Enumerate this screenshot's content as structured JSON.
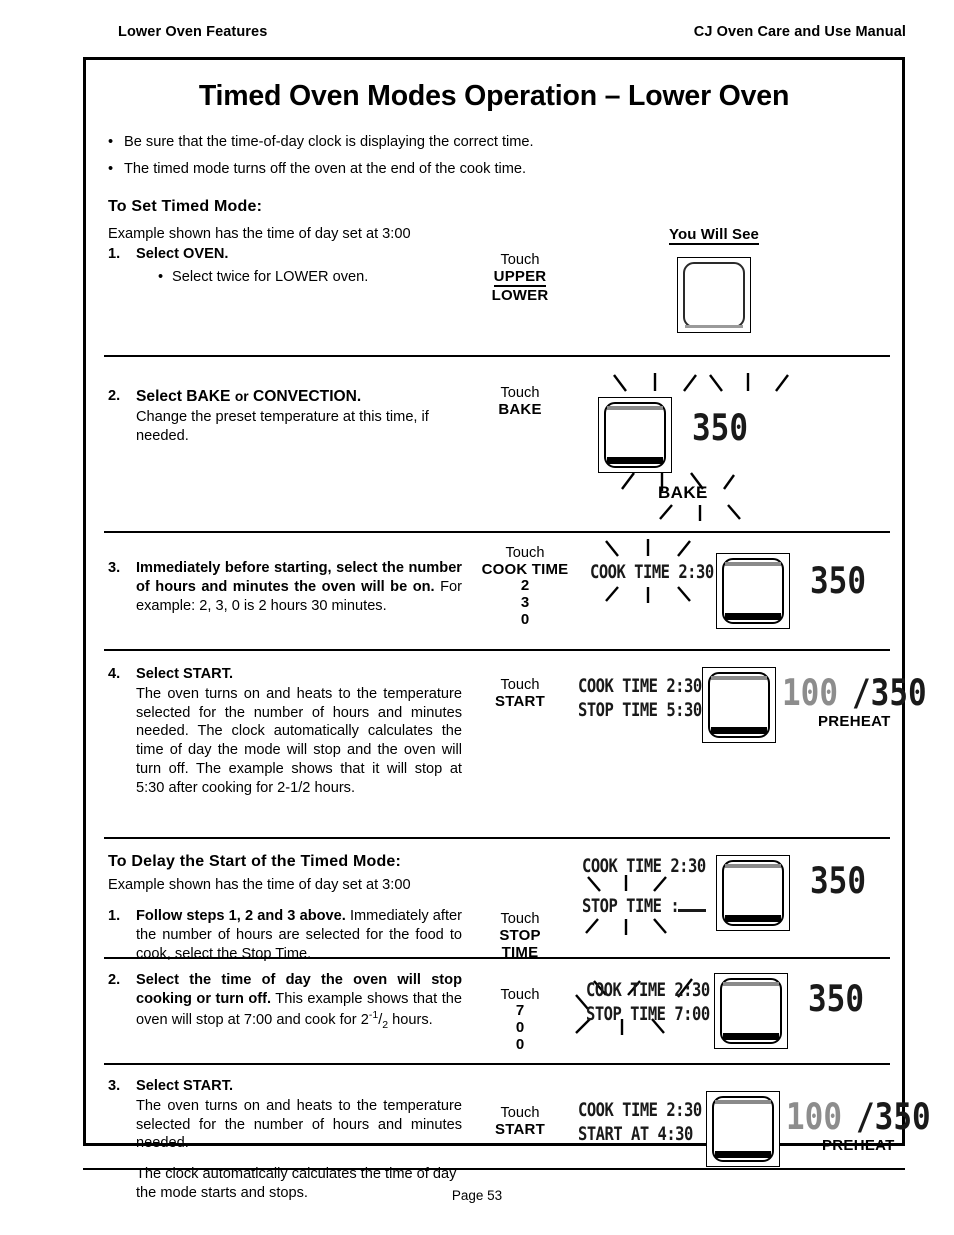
{
  "runhead": {
    "left": "Lower Oven Features",
    "right": "CJ Oven Care and Use Manual"
  },
  "title": "Timed Oven Modes Operation – Lower Oven",
  "intro_bullets": [
    "Be sure that the time-of-day clock is displaying the correct time.",
    "The timed mode turns off the oven at the end of the cook time."
  ],
  "section1": {
    "heading": "To Set Timed Mode:",
    "subtitle": "Example shown has the time of day set at 3:00",
    "you_will_see": "You Will See"
  },
  "step1": {
    "num": "1.",
    "title": "Select OVEN.",
    "sub_bullet": "Select twice for LOWER oven.",
    "touch_word": "Touch",
    "touch_key_1": "UPPER",
    "touch_key_2": "LOWER"
  },
  "step2": {
    "num": "2.",
    "title_a": "Select  BAKE",
    "title_or": "or",
    "title_b": "CONVECTION.",
    "body": "Change the preset temperature at this time, if needed.",
    "touch_word": "Touch",
    "touch_key": "BAKE",
    "display_temp": "350",
    "display_mode": "BAKE"
  },
  "step3": {
    "num": "3.",
    "bold": "Immediately before starting, select the number of hours and minutes the oven will be on.",
    "rest": " For example: 2, 3, 0 is 2 hours 30 minutes.",
    "touch_word": "Touch",
    "touch_key": "COOK TIME",
    "digits": [
      "2",
      "3",
      "0"
    ],
    "display_line1": "COOK TIME 2:30",
    "display_temp": "350"
  },
  "step4": {
    "num": "4.",
    "title": "Select START.",
    "body": "The oven turns on and heats to the temperature selected for the number of hours and minutes needed. The clock automatically calculates the time of day the mode will stop and the oven will turn off. The example shows that it will stop at 5:30 after cooking for 2-1/2 hours.",
    "touch_word": "Touch",
    "touch_key": "START",
    "display_line1": "COOK TIME 2:30",
    "display_line2": "STOP TIME 5:30",
    "display_temp_current": "100",
    "display_temp_set": "/350",
    "display_status": "PREHEAT"
  },
  "section2": {
    "heading": "To Delay the Start of the Timed Mode:",
    "subtitle": "Example shown has the time of day set at 3:00"
  },
  "delay_step1": {
    "num": "1.",
    "bold": "Follow steps 1, 2 and 3 above.",
    "rest": " Immediately after the number of hours are selected for the food to cook,  select the Stop Time.",
    "touch_word": "Touch",
    "touch_key_1": "STOP",
    "touch_key_2": "TIME",
    "display_line1": "COOK TIME 2:30",
    "display_line2": "STOP TIME  :",
    "display_temp": "350"
  },
  "delay_step2": {
    "num": "2.",
    "bold": "Select the time of day the oven will stop cooking or turn off.",
    "rest_a": " This example shows that the oven will stop at 7:00 and cook for 2",
    "frac_sup": "-1",
    "frac_sub": "2",
    "rest_b": " hours.",
    "touch_word": "Touch",
    "digits": [
      "7",
      "0",
      "0"
    ],
    "display_line1": "COOK TIME 2:30",
    "display_line2": "STOP TIME 7:00",
    "display_temp": "350"
  },
  "delay_step3": {
    "num": "3.",
    "title": "Select START.",
    "body_a": "The oven turns on and heats to the temperature selected for the number of hours and minutes needed.",
    "body_b": "The clock automatically calculates the time of day the mode starts and stops.",
    "touch_word": "Touch",
    "touch_key": "START",
    "display_line1": "COOK TIME 2:30",
    "display_line2": "START AT  4:30",
    "display_temp_current": "100",
    "display_temp_set": "/350",
    "display_status": "PREHEAT"
  },
  "footer": {
    "page": "Page 53"
  },
  "colors": {
    "ink": "#000000",
    "lcd_gray": "#8d8d8d",
    "panel_gray": "#8a8a8a"
  }
}
